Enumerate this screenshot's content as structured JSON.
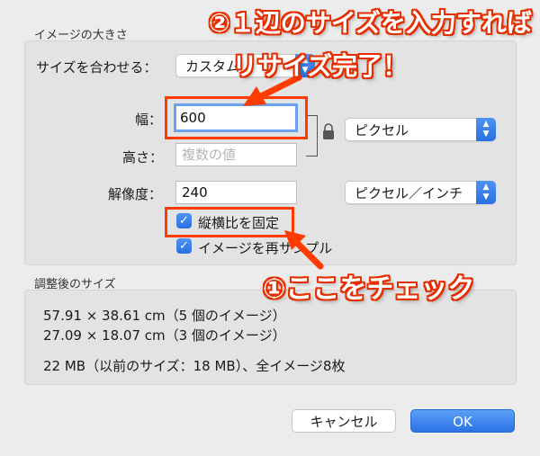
{
  "image_size": {
    "section_title": "イメージの大きさ",
    "fit_label": "サイズを合わせる：",
    "fit_value": "カスタム",
    "width_label": "幅：",
    "width_value": "600",
    "height_label": "高さ：",
    "height_placeholder": "複数の値",
    "unit_value": "ピクセル",
    "resolution_label": "解像度：",
    "resolution_value": "240",
    "resolution_unit": "ピクセル／インチ",
    "keep_ratio_label": "縦横比を固定",
    "keep_ratio_checked": true,
    "resample_label": "イメージを再サンプル",
    "resample_checked": true
  },
  "result": {
    "section_title": "調整後のサイズ",
    "lines": [
      "57.91 × 38.61 cm（5 個のイメージ）",
      "27.09 × 18.07 cm（3 個のイメージ）",
      "22 MB（以前のサイズ：18 MB）、全イメージ8枚"
    ]
  },
  "buttons": {
    "cancel": "キャンセル",
    "ok": "OK"
  },
  "annotations": {
    "step2_line1": "②１辺のサイズを入力すれば",
    "step2_line2": "リサイズ完了！",
    "step1": "①ここをチェック"
  },
  "colors": {
    "accent": "#2a6fe0",
    "annotation_red": "#ff3b00"
  }
}
